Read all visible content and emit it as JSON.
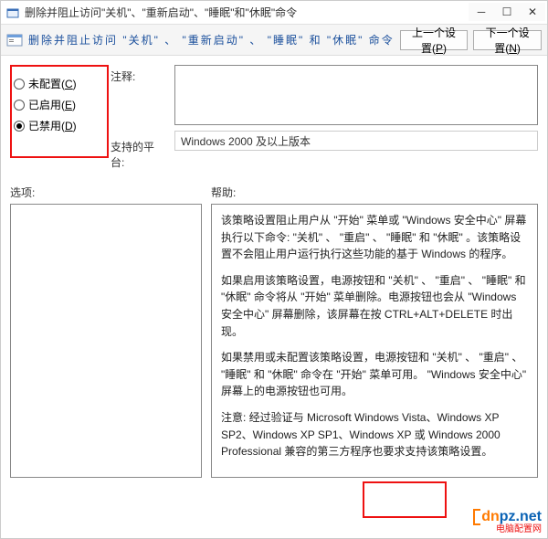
{
  "titlebar": {
    "title": "删除并阻止访问\"关机\"、\"重新启动\"、\"睡眠\"和\"休眠\"命令"
  },
  "toolbar": {
    "title": "删除并阻止访问 \"关机\" 、 \"重新启动\" 、 \"睡眠\" 和 \"休眠\" 命令",
    "prev_btn": "上一个设置(P)",
    "next_btn": "下一个设置(N)"
  },
  "radios": {
    "not_configured": "未配置(C)",
    "enabled": "已启用(E)",
    "disabled": "已禁用(D)",
    "selected": "disabled"
  },
  "labels": {
    "comment": "注释:",
    "supported": "支持的平台:",
    "options": "选项:",
    "help": "帮助:"
  },
  "platform": {
    "value": "Windows 2000 及以上版本"
  },
  "help": {
    "p1": "该策略设置阻止用户从 \"开始\" 菜单或 \"Windows 安全中心\" 屏幕执行以下命令: \"关机\" 、 \"重启\" 、 \"睡眠\" 和 \"休眠\" 。该策略设置不会阻止用户运行执行这些功能的基于 Windows 的程序。",
    "p2": "如果启用该策略设置，电源按钮和 \"关机\" 、 \"重启\" 、 \"睡眠\" 和 \"休眠\" 命令将从 \"开始\" 菜单删除。电源按钮也会从 \"Windows 安全中心\" 屏幕删除，该屏幕在按 CTRL+ALT+DELETE 时出现。",
    "p3": "如果禁用或未配置该策略设置，电源按钮和 \"关机\" 、 \"重启\" 、 \"睡眠\" 和 \"休眠\" 命令在 \"开始\" 菜单可用。 \"Windows 安全中心\" 屏幕上的电源按钮也可用。",
    "p4": "注意: 经过验证与 Microsoft Windows Vista、Windows XP SP2、Windows XP SP1、Windows XP 或 Windows 2000 Professional 兼容的第三方程序也要求支持该策略设置。"
  },
  "watermark": {
    "brand1": "dn",
    "brand2": "pz",
    "suffix": ".net",
    "tag": "电脑配置网"
  },
  "icons": {
    "app": "app-icon",
    "policy": "policy-icon"
  }
}
